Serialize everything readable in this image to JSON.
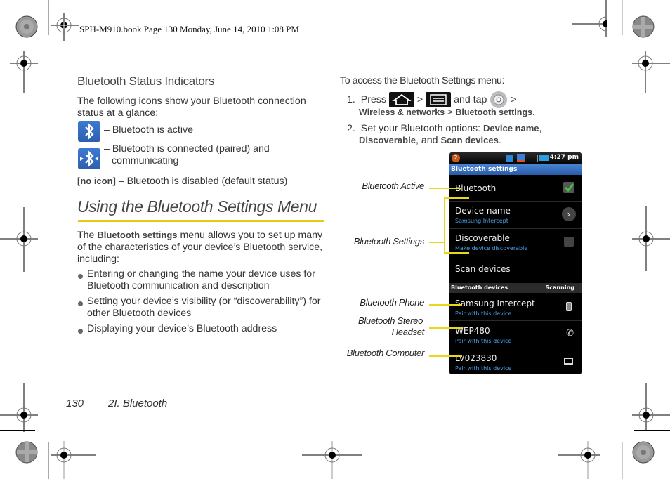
{
  "header": {
    "book_line": "SPH-M910.book  Page 130  Monday, June 14, 2010  1:08 PM"
  },
  "left": {
    "section_title": "Bluetooth Status Indicators",
    "intro": "The following icons show your Bluetooth connection status at a glance:",
    "indicators": [
      {
        "icon": "bluetooth-active-icon",
        "text": "– Bluetooth is active"
      },
      {
        "icon": "bluetooth-connected-icon",
        "text": "– Bluetooth is connected (paired) and communicating"
      }
    ],
    "no_icon_label": "[no icon]",
    "no_icon_text": " – Bluetooth is disabled (default status)",
    "heading": "Using the Bluetooth Settings Menu",
    "para_prefix": "The ",
    "para_bold": "Bluetooth settings",
    "para_suffix": " menu allows you to set up many of the characteristics of your device’s Bluetooth service, including:",
    "bullets": [
      "Entering or changing the name your device uses for Bluetooth communication and description",
      "Setting your device’s visibility (or “discoverability”) for other Bluetooth devices",
      "Displaying your device’s Bluetooth address"
    ]
  },
  "right": {
    "access_intro": "To access the Bluetooth Settings menu:",
    "step1": {
      "num": "1.",
      "press": "Press",
      "gt": ">",
      "and_tap": "and tap",
      "path_a": "Wireless & networks",
      "path_b": "Bluetooth settings",
      "end": "."
    },
    "step2": {
      "num": "2.",
      "text": "Set your Bluetooth options: ",
      "opt1": "Device name",
      "comma1": ",",
      "opt2": "Discoverable",
      "and": ", and ",
      "opt3": "Scan devices",
      "end": "."
    },
    "callouts": [
      "Bluetooth Active",
      "Bluetooth Settings",
      "Bluetooth Phone",
      "Bluetooth Stereo",
      "Headset",
      "Bluetooth Computer"
    ]
  },
  "phone": {
    "notification_count": "2",
    "time": "4:27 pm",
    "title": "Bluetooth settings",
    "bluetooth_label": "Bluetooth",
    "bluetooth_checked": true,
    "device_name_label": "Device name",
    "device_name_value": "Samsung Intercept",
    "discoverable_label": "Discoverable",
    "discoverable_sub": "Make device discoverable",
    "discoverable_checked": false,
    "scan_label": "Scan devices",
    "devices_header": "Bluetooth devices",
    "scanning": "Scanning",
    "devices": [
      {
        "name": "Samsung Intercept",
        "sub": "Pair with this device",
        "icon": "phone-icon"
      },
      {
        "name": "WEP480",
        "sub": "Pair with this device",
        "icon": "headset-icon"
      },
      {
        "name": "LV023830",
        "sub": "Pair with this device",
        "icon": "computer-icon"
      }
    ]
  },
  "footer": {
    "page_number": "130",
    "chapter": "2I. Bluetooth"
  }
}
